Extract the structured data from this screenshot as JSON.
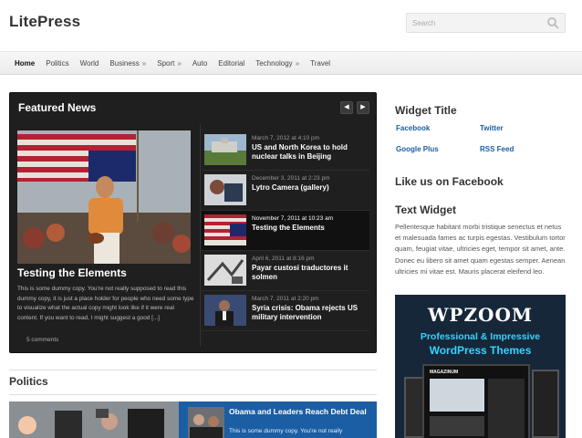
{
  "header": {
    "site_title": "LitePress",
    "search_placeholder": "Search"
  },
  "nav": {
    "items": [
      {
        "label": "Home",
        "active": true,
        "dropdown": false
      },
      {
        "label": "Politics",
        "dropdown": false
      },
      {
        "label": "World",
        "dropdown": false
      },
      {
        "label": "Business",
        "dropdown": true
      },
      {
        "label": "Sport",
        "dropdown": true
      },
      {
        "label": "Auto",
        "dropdown": false
      },
      {
        "label": "Editorial",
        "dropdown": false
      },
      {
        "label": "Technology",
        "dropdown": true
      },
      {
        "label": "Travel",
        "dropdown": false
      }
    ],
    "dropdown_marker": "»"
  },
  "featured": {
    "title": "Featured News",
    "prev_label": "◀",
    "next_label": "▶",
    "main": {
      "title": "Testing the Elements",
      "excerpt": "This is some dummy copy. You're not really supposed to read this dummy copy, it is just a place holder for people who need some type to visualize what the actual copy might look like if it were real content. If you want to read, I might suggest a good [...]",
      "comments": "5 comments"
    },
    "items": [
      {
        "date": "March 7, 2012 at 4:10 pm",
        "title": "US and North Korea to hold nuclear talks in Beijing",
        "highlighted": false
      },
      {
        "date": "December 3, 2011 at 2:23 pm",
        "title": "Lytro Camera (gallery)",
        "highlighted": false
      },
      {
        "date": "November 7, 2011 at 10:23 am",
        "title": "Testing the Elements",
        "highlighted": true
      },
      {
        "date": "April 6, 2011 at 8:16 pm",
        "title": "Payar custosi traductores it solmen",
        "highlighted": false
      },
      {
        "date": "March 7, 2011 at 2:20 pm",
        "title": "Syria crisis: Obama rejects US military intervention",
        "highlighted": false
      }
    ]
  },
  "politics": {
    "section_title": "Politics",
    "lead_title": "Obama and Leaders Reach Debt Deal",
    "lead_excerpt": "This is some dummy copy. You're not really"
  },
  "sidebar": {
    "widget_title": "Widget Title",
    "links": [
      "Facebook",
      "Twitter",
      "Google Plus",
      "RSS Feed"
    ],
    "facebook_title": "Like us on Facebook",
    "text_widget_title": "Text Widget",
    "text_widget_body": "Pellentesque habitant morbi tristique senectus et netus et malesuada fames ac turpis egestas. Vestibulum tortor quam, feugiat vitae, ultricies eget, tempor sit amet, ante. Donec eu libero sit amet quam egestas semper. Aenean ultricies mi vitae est. Mauris placerat eleifend leo.",
    "ad": {
      "brand": "WPZOOM",
      "line1": "Professional & Impressive",
      "line2": "WordPress Themes",
      "screen_label": "MAGAZINUM"
    }
  },
  "colors": {
    "accent": "#1b5ea3",
    "featured_bg": "#1f1f1f",
    "ad_bg": "#16273a",
    "ad_text": "#36d3ff"
  }
}
